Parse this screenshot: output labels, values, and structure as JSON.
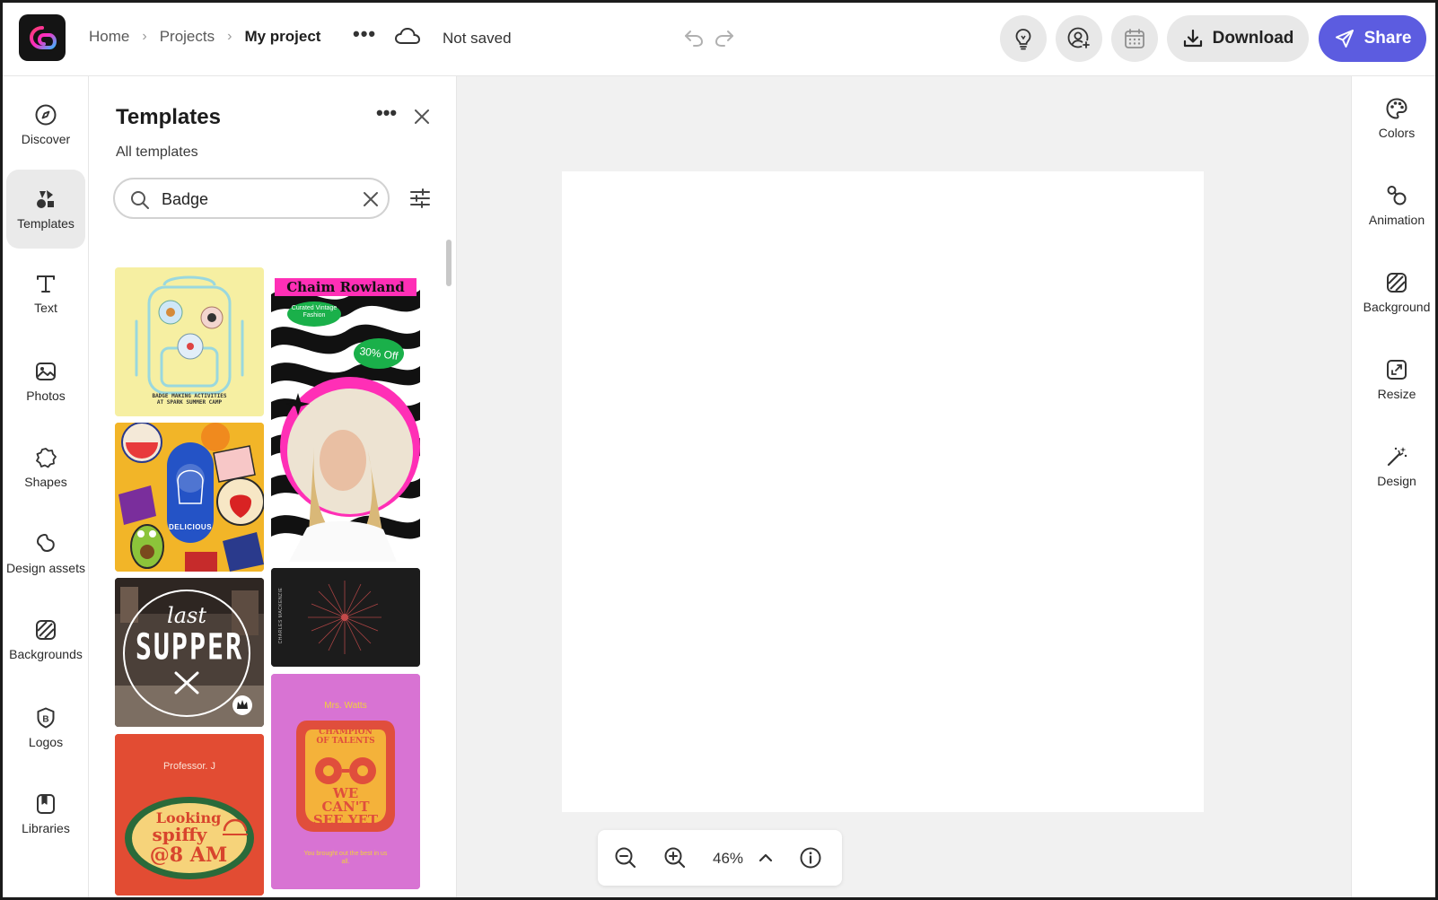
{
  "header": {
    "breadcrumb": [
      "Home",
      "Projects",
      "My project"
    ],
    "save_status": "Not saved",
    "download_label": "Download",
    "share_label": "Share"
  },
  "left_rail": [
    {
      "label": "Discover",
      "icon": "compass-icon"
    },
    {
      "label": "Templates",
      "icon": "templates-icon",
      "active": true
    },
    {
      "label": "Text",
      "icon": "text-icon"
    },
    {
      "label": "Photos",
      "icon": "photo-icon"
    },
    {
      "label": "Shapes",
      "icon": "shapes-icon"
    },
    {
      "label": "Design assets",
      "icon": "design-assets-icon"
    },
    {
      "label": "Backgrounds",
      "icon": "backgrounds-icon"
    },
    {
      "label": "Logos",
      "icon": "logo-icon"
    },
    {
      "label": "Libraries",
      "icon": "libraries-icon"
    }
  ],
  "panel": {
    "title": "Templates",
    "subtitle": "All templates",
    "search_value": "Badge"
  },
  "templates": {
    "t1_caption": "BADGE MAKING ACTIVITIES AT SPARK SUMMER CAMP",
    "t2_title": "Chaim Rowland",
    "t2_tag": "Curated Vintage Fashion",
    "t2_offer": "30% Off",
    "t3_badge": "DELICIOUS",
    "t4_title": "last",
    "t4_word": "SUPPER",
    "t5_name": "CHARLES MACKENZIE",
    "t6_name": "Mrs. Watts",
    "t6_badge_top": "CHAMPION OF TALENTS",
    "t6_badge_bottom": "WE CAN'T SEE YET",
    "t6_footer": "You brought out the best in us all.",
    "t7_name": "Professor. J",
    "t7_line1": "Looking",
    "t7_line2": "spiffy",
    "t7_line3": "@8 AM"
  },
  "canvas": {
    "zoom": "46%"
  },
  "right_rail": [
    {
      "label": "Colors",
      "icon": "palette-icon"
    },
    {
      "label": "Animation",
      "icon": "animation-icon"
    },
    {
      "label": "Background",
      "icon": "background-icon"
    },
    {
      "label": "Resize",
      "icon": "resize-icon"
    },
    {
      "label": "Design",
      "icon": "magic-wand-icon"
    }
  ],
  "colors": {
    "accent": "#5c5ce0",
    "app_bg": "#f1f1f1"
  }
}
